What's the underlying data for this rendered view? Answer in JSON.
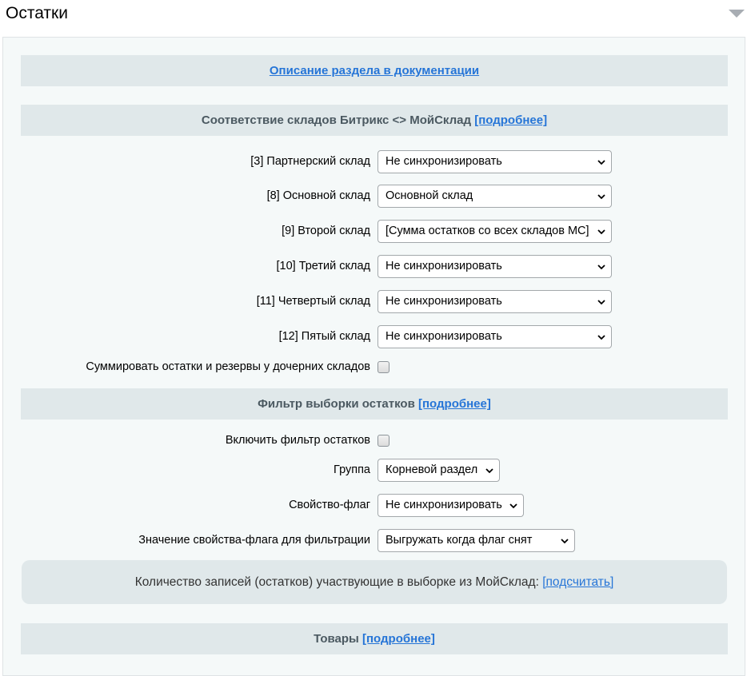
{
  "header": {
    "title": "Остатки",
    "collapse_icon": "chevron-down-icon"
  },
  "doc_link": "Описание раздела в документации",
  "stores_section": {
    "title": "Соответствие складов Битрикс <> МойСклад",
    "more": "[подробнее]"
  },
  "stores": [
    {
      "label": "[3] Партнерский склад",
      "value": "Не синхронизировать"
    },
    {
      "label": "[8] Основной склад",
      "value": "Основной склад"
    },
    {
      "label": "[9] Второй склад",
      "value": "[Сумма остатков со всех складов МС]"
    },
    {
      "label": "[10] Третий склад",
      "value": "Не синхронизировать"
    },
    {
      "label": "[11] Четвертый склад",
      "value": "Не синхронизировать"
    },
    {
      "label": "[12] Пятый склад",
      "value": "Не синхронизировать"
    }
  ],
  "sum_children": {
    "label": "Суммировать остатки и резервы у дочерних складов",
    "checked": false
  },
  "filter_section": {
    "title": "Фильтр выборки остатков",
    "more": "[подробнее]"
  },
  "filter": {
    "enable_label": "Включить фильтр остатков",
    "enable_checked": false,
    "group_label": "Группа",
    "group_value": "Корневой раздел",
    "flag_label": "Свойство-флаг",
    "flag_value": "Не синхронизировать",
    "flag_value_label": "Значение свойства-флага для фильтрации",
    "flag_value_value": "Выгружать когда флаг снят"
  },
  "count_note": {
    "text": "Количество записей (остатков) участвующие в выборке из МойСклад:",
    "link": "[подсчитать]"
  },
  "goods_section": {
    "title": "Товары",
    "more": "[подробнее]"
  }
}
